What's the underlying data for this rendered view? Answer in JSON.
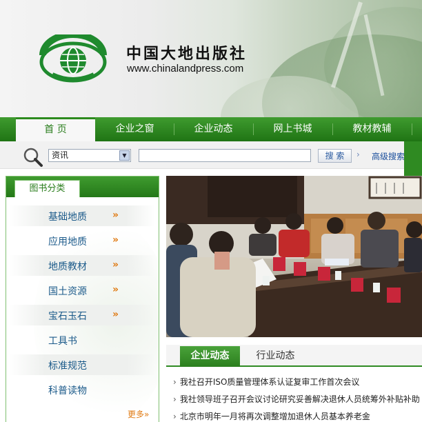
{
  "header": {
    "brand_name": "中国大地出版社",
    "brand_url": "www.chinalandpress.com"
  },
  "nav": {
    "items": [
      {
        "label": "首  页",
        "active": true
      },
      {
        "label": "企业之窗"
      },
      {
        "label": "企业动态"
      },
      {
        "label": "网上书城"
      },
      {
        "label": "教材教辅"
      }
    ]
  },
  "search": {
    "select_value": "资讯",
    "button_label": "搜  索",
    "advanced_label": "高级搜索"
  },
  "sidebar": {
    "title": "图书分类",
    "items": [
      {
        "label": "基础地质",
        "chevron": "»"
      },
      {
        "label": "应用地质",
        "chevron": "»"
      },
      {
        "label": "地质教材",
        "chevron": "»"
      },
      {
        "label": "国土资源",
        "chevron": "»"
      },
      {
        "label": "宝石玉石",
        "chevron": "»"
      },
      {
        "label": "工具书"
      },
      {
        "label": "标准规范"
      },
      {
        "label": "科普读物"
      }
    ],
    "more_label": "更多»"
  },
  "news": {
    "tabs": [
      {
        "label": "企业动态",
        "active": true
      },
      {
        "label": "行业动态"
      }
    ],
    "items": [
      "我社召开ISO质量管理体系认证复审工作首次会议",
      "我社领导班子召开会议讨论研究妥善解决退休人员统筹外补贴补助",
      "北京市明年一月将再次调整增加退休人员基本养老金"
    ]
  },
  "colors": {
    "nav_green": "#2a8a1d",
    "accent_orange": "#e07b14",
    "link_blue": "#1b5a8a"
  }
}
